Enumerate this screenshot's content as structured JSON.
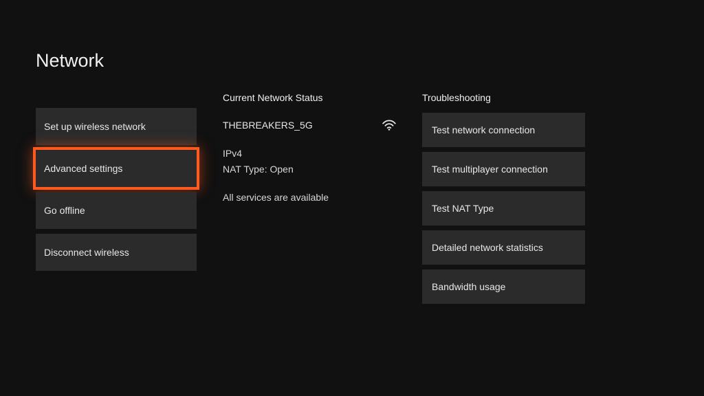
{
  "page_title": "Network",
  "left_menu": {
    "setup_wireless": "Set up wireless network",
    "advanced_settings": "Advanced settings",
    "go_offline": "Go offline",
    "disconnect_wireless": "Disconnect wireless"
  },
  "status": {
    "header": "Current Network Status",
    "ssid": "THEBREAKERS_5G",
    "ip_version": "IPv4",
    "nat": "NAT Type: Open",
    "services": "All services are available"
  },
  "troubleshooting": {
    "header": "Troubleshooting",
    "test_connection": "Test network connection",
    "test_multiplayer": "Test multiplayer connection",
    "test_nat": "Test NAT Type",
    "detailed_stats": "Detailed network statistics",
    "bandwidth": "Bandwidth usage"
  }
}
